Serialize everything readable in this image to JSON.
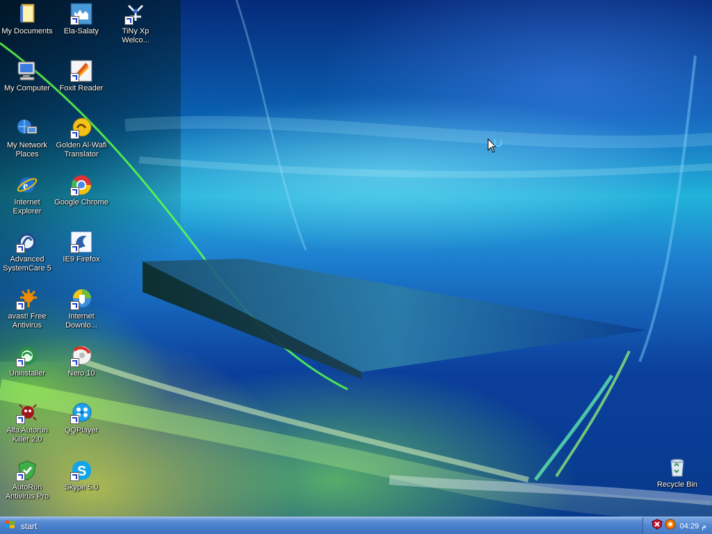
{
  "desktop": {
    "icons": [
      {
        "label": "My Documents",
        "icon": "folder-documents-icon"
      },
      {
        "label": "Ela-Salaty",
        "icon": "ela-salaty-icon"
      },
      {
        "label": "TiNy Xp Welco...",
        "icon": "tiny-xp-icon"
      },
      {
        "label": "My Computer",
        "icon": "computer-icon"
      },
      {
        "label": "Foxit Reader",
        "icon": "foxit-reader-icon"
      },
      {
        "label": "My Network Places",
        "icon": "network-places-icon"
      },
      {
        "label": "Golden Al-Wafi Translator",
        "icon": "golden-translator-icon"
      },
      {
        "label": "Internet Explorer",
        "icon": "internet-explorer-icon"
      },
      {
        "label": "Google Chrome",
        "icon": "chrome-icon"
      },
      {
        "label": "Advanced SystemCare 5",
        "icon": "systemcare-icon"
      },
      {
        "label": "IE9 Firefox",
        "icon": "ie9-firefox-icon"
      },
      {
        "label": "avast! Free Antivirus",
        "icon": "avast-icon"
      },
      {
        "label": "Internet Downlo...",
        "icon": "internet-download-icon"
      },
      {
        "label": "Uninstaller",
        "icon": "uninstaller-icon"
      },
      {
        "label": "Nero 10",
        "icon": "nero-icon"
      },
      {
        "label": "Alfa Autorun Killer 2.0",
        "icon": "autorun-killer-icon"
      },
      {
        "label": "QQPlayer",
        "icon": "qqplayer-icon"
      },
      {
        "label": "AutoRun Antivirus Pro",
        "icon": "autorun-antivirus-icon"
      },
      {
        "label": "Skype 5.0",
        "icon": "skype-icon"
      },
      {
        "label": "Recycle Bin",
        "icon": "recycle-bin-icon"
      }
    ]
  },
  "taskbar": {
    "start_label": "start",
    "clock": "04:29",
    "ampm": "م"
  },
  "colors": {
    "taskbar": "#4a7fcb",
    "wallpaper_blue": "#0a5fb0",
    "wallpaper_green": "#7ac850"
  }
}
